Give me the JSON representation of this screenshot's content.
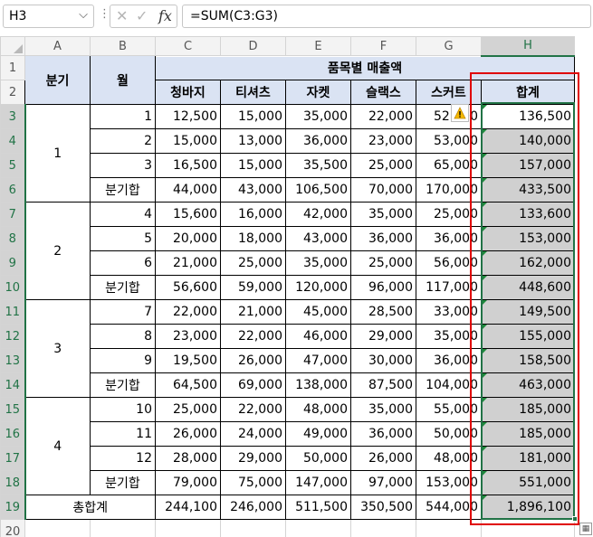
{
  "formula_bar": {
    "name_box": "H3",
    "formula": "=SUM(C3:G3)",
    "cancel_icon": "x-icon",
    "enter_icon": "check-icon",
    "function_icon": "fx-icon"
  },
  "grid": {
    "columns": [
      "A",
      "B",
      "C",
      "D",
      "E",
      "F",
      "G",
      "H"
    ],
    "rows": [
      "1",
      "2",
      "3",
      "4",
      "5",
      "6",
      "7",
      "8",
      "9",
      "10",
      "11",
      "12",
      "13",
      "14",
      "15",
      "16",
      "17",
      "18",
      "19",
      "20"
    ],
    "header": {
      "quarter": "분기",
      "month": "월",
      "group_title": "품목별 매출액",
      "items": [
        "청바지",
        "티셔츠",
        "자켓",
        "슬랙스",
        "스커트"
      ],
      "total": "합계"
    },
    "quarters": [
      {
        "label": "1",
        "rows": [
          {
            "month": "1",
            "values": [
              "12,500",
              "15,000",
              "35,000",
              "22,000",
              "52,000"
            ],
            "total": "136,500"
          },
          {
            "month": "2",
            "values": [
              "15,000",
              "13,000",
              "36,000",
              "23,000",
              "53,000"
            ],
            "total": "140,000"
          },
          {
            "month": "3",
            "values": [
              "16,500",
              "15,000",
              "35,500",
              "25,000",
              "65,000"
            ],
            "total": "157,000"
          }
        ],
        "subtotal": {
          "label": "분기합",
          "values": [
            "44,000",
            "43,000",
            "106,500",
            "70,000",
            "170,000"
          ],
          "total": "433,500"
        }
      },
      {
        "label": "2",
        "rows": [
          {
            "month": "4",
            "values": [
              "15,600",
              "16,000",
              "42,000",
              "35,000",
              "25,000"
            ],
            "total": "133,600"
          },
          {
            "month": "5",
            "values": [
              "20,000",
              "18,000",
              "43,000",
              "36,000",
              "36,000"
            ],
            "total": "153,000"
          },
          {
            "month": "6",
            "values": [
              "21,000",
              "25,000",
              "35,000",
              "25,000",
              "56,000"
            ],
            "total": "162,000"
          }
        ],
        "subtotal": {
          "label": "분기합",
          "values": [
            "56,600",
            "59,000",
            "120,000",
            "96,000",
            "117,000"
          ],
          "total": "448,600"
        }
      },
      {
        "label": "3",
        "rows": [
          {
            "month": "7",
            "values": [
              "22,000",
              "21,000",
              "45,000",
              "28,500",
              "33,000"
            ],
            "total": "149,500"
          },
          {
            "month": "8",
            "values": [
              "23,000",
              "22,000",
              "46,000",
              "29,000",
              "35,000"
            ],
            "total": "155,000"
          },
          {
            "month": "9",
            "values": [
              "19,500",
              "26,000",
              "47,000",
              "30,000",
              "36,000"
            ],
            "total": "158,500"
          }
        ],
        "subtotal": {
          "label": "분기합",
          "values": [
            "64,500",
            "69,000",
            "138,000",
            "87,500",
            "104,000"
          ],
          "total": "463,000"
        }
      },
      {
        "label": "4",
        "rows": [
          {
            "month": "10",
            "values": [
              "25,000",
              "22,000",
              "48,000",
              "35,000",
              "55,000"
            ],
            "total": "185,000"
          },
          {
            "month": "11",
            "values": [
              "26,000",
              "24,000",
              "49,000",
              "36,000",
              "50,000"
            ],
            "total": "185,000"
          },
          {
            "month": "12",
            "values": [
              "28,000",
              "29,000",
              "50,000",
              "26,000",
              "48,000"
            ],
            "total": "181,000"
          }
        ],
        "subtotal": {
          "label": "분기합",
          "values": [
            "79,000",
            "75,000",
            "147,000",
            "97,000",
            "153,000"
          ],
          "total": "551,000"
        }
      }
    ],
    "grand_total": {
      "label": "총합계",
      "values": [
        "244,100",
        "246,000",
        "511,500",
        "350,500",
        "544,000"
      ],
      "total": "1,896,100"
    }
  },
  "colors": {
    "header_fill": "#dae3f3",
    "selection_fill": "#d0d0d0",
    "selection_border": "#217346",
    "highlight_box": "#e00000"
  },
  "icons": {
    "warning": "warning-icon",
    "quick_analysis": "quick-analysis-icon"
  }
}
